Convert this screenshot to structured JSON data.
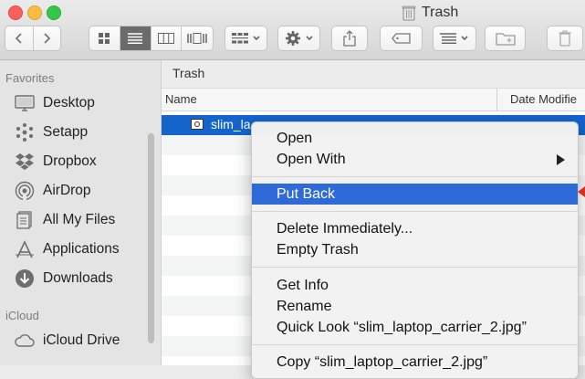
{
  "window": {
    "title": "Trash"
  },
  "toolbar": {
    "icons": [
      "chevron-left-icon",
      "chevron-right-icon",
      "icon-view-icon",
      "list-view-icon",
      "column-view-icon",
      "coverflow-view-icon",
      "arrange-icon",
      "gear-icon",
      "share-icon",
      "tag-icon",
      "sort-icon",
      "new-folder-icon",
      "trash-icon"
    ]
  },
  "sidebar": {
    "favorites_header": "Favorites",
    "items": [
      {
        "label": "Desktop",
        "icon": "desktop-icon"
      },
      {
        "label": "Setapp",
        "icon": "setapp-icon"
      },
      {
        "label": "Dropbox",
        "icon": "dropbox-icon"
      },
      {
        "label": "AirDrop",
        "icon": "airdrop-icon"
      },
      {
        "label": "All My Files",
        "icon": "files-icon"
      },
      {
        "label": "Applications",
        "icon": "applications-icon"
      },
      {
        "label": "Downloads",
        "icon": "downloads-icon"
      }
    ],
    "icloud_header": "iCloud",
    "icloud_items": [
      {
        "label": "iCloud Drive",
        "icon": "cloud-icon"
      }
    ]
  },
  "main": {
    "path": "Trash",
    "columns": [
      "Name",
      "Date Modifie"
    ],
    "selected_file": "slim_la"
  },
  "context_menu": {
    "items": [
      "Open",
      "Open With",
      "Put Back",
      "Delete Immediately...",
      "Empty Trash",
      "Get Info",
      "Rename",
      "Quick Look “slim_laptop_carrier_2.jpg”",
      "Copy “slim_laptop_carrier_2.jpg”"
    ],
    "highlighted": "Put Back"
  },
  "colors": {
    "selection": "#1464cc",
    "highlight": "#2e6bd8",
    "annotation_arrow": "#d93025"
  }
}
